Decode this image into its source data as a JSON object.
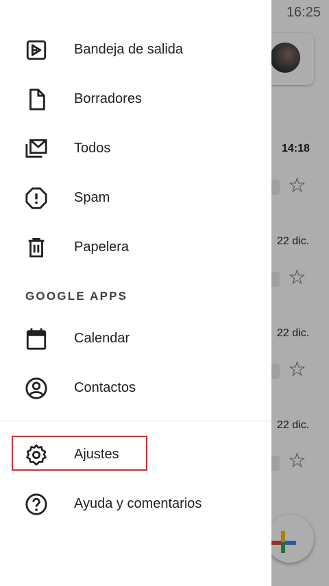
{
  "status_bar": {
    "time": "16:25"
  },
  "background": {
    "times": [
      "14:18",
      "22 dic.",
      "22 dic.",
      "22 dic."
    ]
  },
  "drawer": {
    "items": [
      {
        "label": "Bandeja de salida",
        "icon": "outbox-icon"
      },
      {
        "label": "Borradores",
        "icon": "draft-icon"
      },
      {
        "label": "Todos",
        "icon": "all-mail-icon"
      },
      {
        "label": "Spam",
        "icon": "spam-icon"
      },
      {
        "label": "Papelera",
        "icon": "trash-icon"
      }
    ],
    "section_header": "GOOGLE APPS",
    "apps": [
      {
        "label": "Calendar",
        "icon": "calendar-icon"
      },
      {
        "label": "Contactos",
        "icon": "contacts-icon"
      }
    ],
    "bottom": [
      {
        "label": "Ajustes",
        "icon": "settings-icon"
      },
      {
        "label": "Ayuda y comentarios",
        "icon": "help-icon"
      }
    ]
  },
  "colors": {
    "highlight": "#d32f2f",
    "icon": "#202124",
    "scrim": "rgba(0,0,0,0.32)"
  }
}
